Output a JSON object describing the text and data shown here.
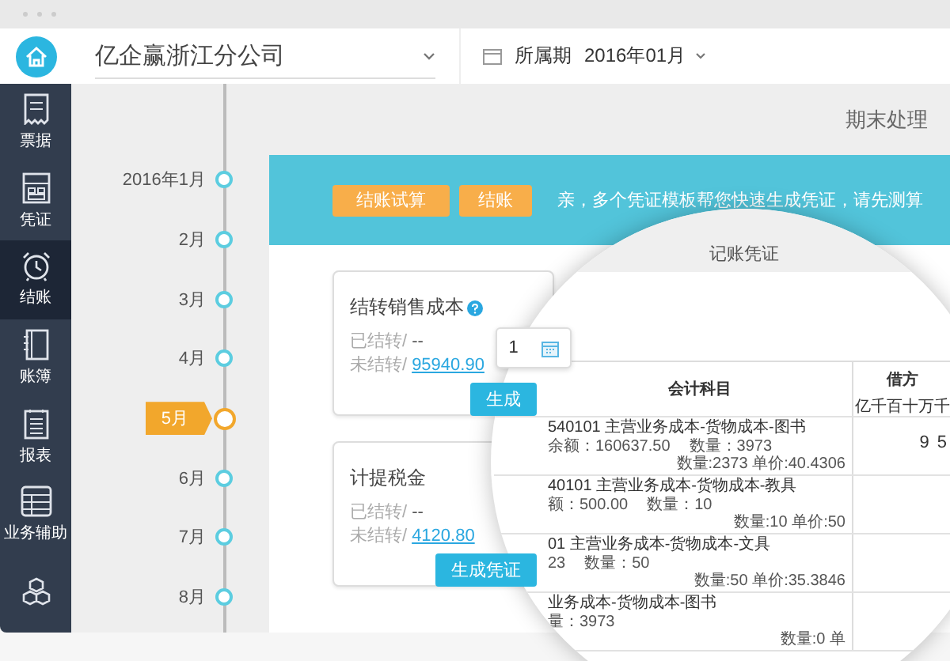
{
  "company_select": {
    "value": "亿企赢浙江分公司"
  },
  "period": {
    "label": "所属期",
    "value": "2016年01月"
  },
  "sidebar": {
    "items": [
      {
        "kind": "receipt",
        "label": "票据",
        "selected": false
      },
      {
        "kind": "voucher",
        "label": "凭证",
        "selected": false
      },
      {
        "kind": "alarm",
        "label": "结账",
        "selected": true
      },
      {
        "kind": "book",
        "label": "账簿",
        "selected": false
      },
      {
        "kind": "report",
        "label": "报表",
        "selected": false
      },
      {
        "kind": "grid",
        "label": "业务辅助",
        "selected": false
      },
      {
        "kind": "cubes",
        "selected": false
      }
    ]
  },
  "timeline": {
    "months": [
      {
        "label": "2016年1月",
        "selected": false
      },
      {
        "label": "2月",
        "selected": false
      },
      {
        "label": "3月",
        "selected": false
      },
      {
        "label": "4月",
        "selected": false
      },
      {
        "label": "5月",
        "selected": true
      },
      {
        "label": "6月",
        "selected": false
      },
      {
        "label": "7月",
        "selected": false
      },
      {
        "label": "8月",
        "selected": false
      }
    ]
  },
  "page_title": "期末处理",
  "banner": {
    "buttons": [
      "结账试算",
      "结账"
    ],
    "message": "亲，多个凭证模板帮您快速生成凭证，请先测算"
  },
  "cards": [
    {
      "title": "结转销售成本",
      "help": true,
      "done_label": "已结转/",
      "done_value": "--",
      "pending_label": "未结转/",
      "pending_value": "95940.90",
      "button": "生成"
    },
    {
      "title": "计提税金",
      "help": false,
      "done_label": "已结转/",
      "done_value": "--",
      "pending_label": "未结转/",
      "pending_value": "4120.80",
      "button": "生成凭证"
    }
  ],
  "date_popup": {
    "value": "1"
  },
  "voucher": {
    "title": "记账凭证",
    "subject_header": "会计科目",
    "debit_header": "借方",
    "digits": [
      "亿",
      "千",
      "百",
      "十",
      "万",
      "千"
    ],
    "rows": [
      {
        "subject": "540101 主营业务成本-货物成本-图书",
        "balance": "余额：160637.50",
        "quantity": "数量：3973",
        "detail": "数量:2373 单价:40.4306",
        "debit": "9 5"
      },
      {
        "subject": "40101 主营业务成本-货物成本-教具",
        "balance": "额：500.00",
        "quantity": "数量：10",
        "detail": "数量:10 单价:50"
      },
      {
        "subject": "01 主营业务成本-货物成本-文具",
        "balance": "23",
        "quantity": "数量：50",
        "detail": "数量:50 单价:35.3846"
      },
      {
        "subject": "业务成本-货物成本-图书",
        "quantity": "量：3973",
        "detail": "数量:0 单"
      }
    ]
  }
}
